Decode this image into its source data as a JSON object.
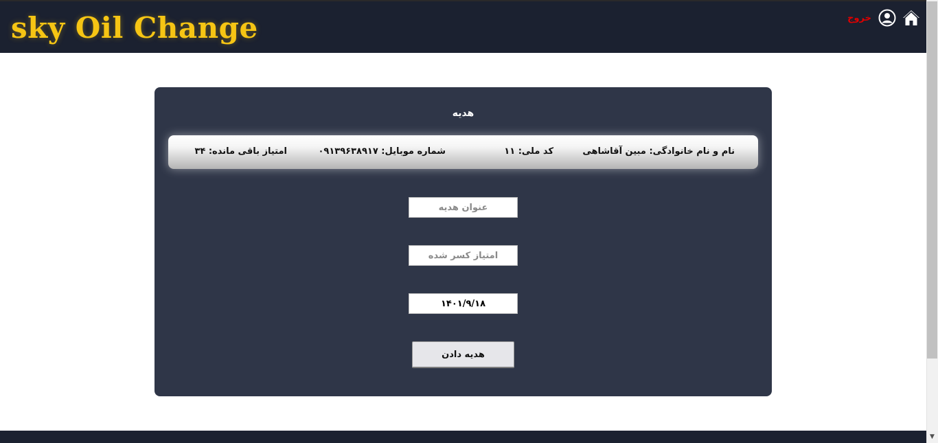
{
  "header": {
    "brand": "sky Oil Change",
    "logout_label": "خروج",
    "icons": {
      "user": "user-circle-icon",
      "home": "home-icon"
    },
    "brand_color": "#f6c514"
  },
  "card": {
    "title": "هدیه",
    "info": {
      "name": "نام و نام خانوادگی: مبین آقاشاهی",
      "national_code": "کد ملی: ۱۱",
      "mobile": "شماره موبایل: ۰۹۱۳۹۶۳۸۹۱۷",
      "remaining_points": "امتیاز باقی مانده: ۳۴"
    },
    "form": {
      "gift_title_placeholder": "عنوان هدیه",
      "deducted_points_placeholder": "امتیاز کسر شده",
      "date_value": "۱۴۰۱/۹/۱۸",
      "submit_label": "هدیه دادن"
    }
  },
  "footer": {
    "text": ""
  },
  "colors": {
    "header_bg": "#1b2130",
    "card_bg": "#2f3648",
    "logout": "#e00000"
  }
}
